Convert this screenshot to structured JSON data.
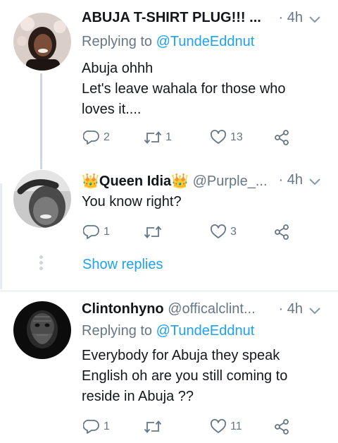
{
  "tweets": [
    {
      "display_name": "ABUJA T-SHIRT PLUG!!! ...",
      "handle": "",
      "time": "· 4h",
      "replying_prefix": "Replying to ",
      "replying_to": "@TundeEddnut",
      "text_lines": [
        "Abuja ohhh",
        "Let's leave wahala for those who",
        "loves it...."
      ],
      "reply_count": "2",
      "retweet_count": "1",
      "like_count": "13",
      "avatar": "avatar-woman-smiling"
    },
    {
      "display_name": "👑Queen Idia👑",
      "handle": "@Purple_...",
      "time": "· 4h",
      "text_lines": [
        "You know right?"
      ],
      "reply_count": "1",
      "retweet_count": "",
      "like_count": "3",
      "show_replies": "Show replies",
      "avatar": "avatar-woman-bw"
    },
    {
      "display_name": "Clintonhyno",
      "handle": "@officalclint...",
      "time": "· 4h",
      "replying_prefix": "Replying to ",
      "replying_to": "@TundeEddnut",
      "text_lines": [
        "Everybody for Abuja they speak",
        "English oh are you still coming to",
        "reside in Abuja ??"
      ],
      "reply_count": "1",
      "retweet_count": "",
      "like_count": "11",
      "avatar": "avatar-dark-face-art"
    }
  ],
  "icons": {
    "reply": "reply-icon",
    "retweet": "retweet-icon",
    "like": "heart-icon",
    "share": "share-icon",
    "caret": "chevron-down-icon"
  },
  "colors": {
    "accent": "#1da1f2",
    "secondary_text": "#657786",
    "thread_line": "#ccd6dd"
  }
}
